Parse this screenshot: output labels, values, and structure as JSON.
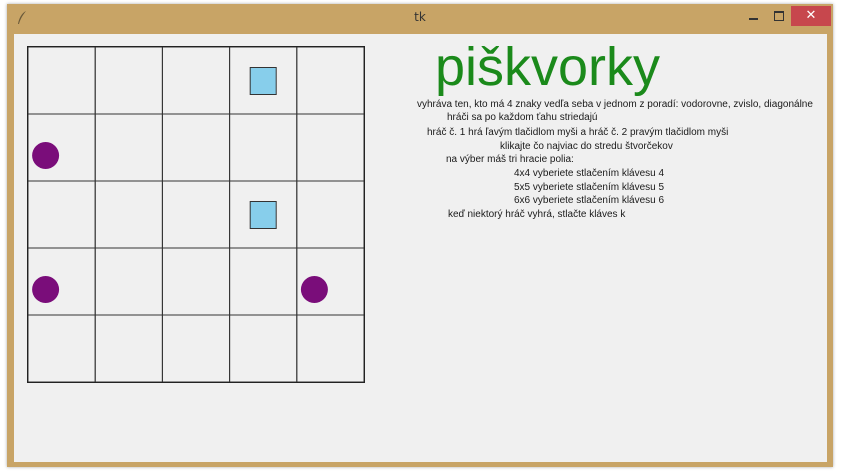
{
  "window": {
    "title": "tk",
    "controls": {
      "minimize": "minimize",
      "maximize": "maximize",
      "close": "✕"
    },
    "accent_colors": {
      "titlebar": "#c8a466",
      "close": "#c7474d",
      "client": "#f0f0f0"
    }
  },
  "game": {
    "heading": "piškvorky",
    "heading_color": "#1b8a1b",
    "board": {
      "rows": 5,
      "cols": 5,
      "pieces": [
        {
          "row": 0,
          "col": 3,
          "type": "square",
          "player": 2
        },
        {
          "row": 1,
          "col": 0,
          "type": "circle",
          "player": 1
        },
        {
          "row": 2,
          "col": 3,
          "type": "square",
          "player": 2
        },
        {
          "row": 3,
          "col": 0,
          "type": "circle",
          "player": 1
        },
        {
          "row": 3,
          "col": 4,
          "type": "circle",
          "player": 1
        }
      ],
      "colors": {
        "circle": "#7a0d7a",
        "square": "#87ceeb",
        "grid": "#333333"
      }
    },
    "instructions": [
      "vyhráva ten, kto má 4 znaky vedľa seba v jednom z poradí: vodorovne, zvislo, diagonálne",
      "hráči sa po každom ťahu striedajú",
      "hráč č. 1 hrá  ľavým tlačidlom myši a hráč č. 2 pravým tlačidlom myši",
      "klikajte čo najviac do stredu štvorčekov",
      "na výber máš tri hracie polia:",
      "4x4 vyberiete stlačením klávesu 4",
      "5x5 vyberiete stlačením klávesu 5",
      "6x6 vyberiete stlačením klávesu 6",
      "keď niektorý hráč vyhrá, stlačte kláves k"
    ]
  }
}
